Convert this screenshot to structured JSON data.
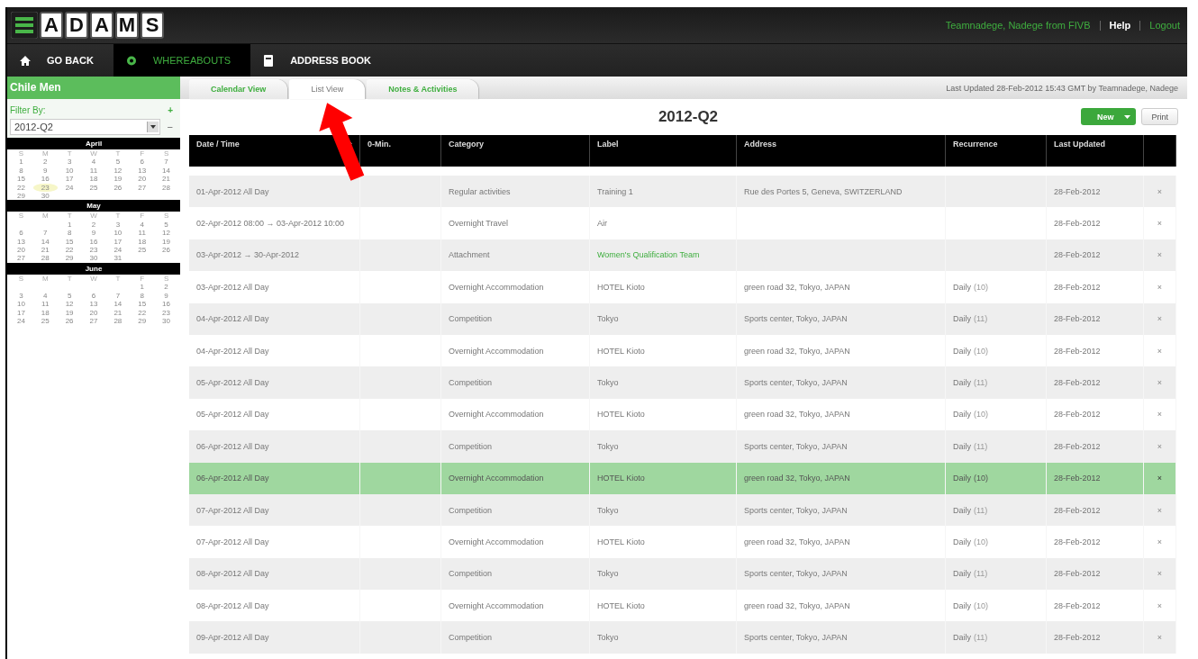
{
  "header": {
    "logo": [
      "A",
      "D",
      "A",
      "M",
      "S"
    ],
    "user": "Teamnadege, Nadege from FIVB",
    "links": [
      "Help",
      "Logout"
    ]
  },
  "nav": [
    {
      "label": "GO BACK",
      "kind": "home",
      "selected": false
    },
    {
      "label": "WHEREABOUTS",
      "kind": "pin",
      "selected": true
    },
    {
      "label": "ADDRESS BOOK",
      "kind": "book",
      "selected": false
    }
  ],
  "sidebar": {
    "title": "Chile Men",
    "filter_label": "Filter By:",
    "add": "+",
    "period": "2012-Q2",
    "remove": "−",
    "months": [
      {
        "name": "April",
        "weekdays": [
          "S",
          "M",
          "T",
          "W",
          "T",
          "F",
          "S"
        ],
        "weeks": [
          [
            "1",
            "2",
            "3",
            "4",
            "5",
            "6",
            "7"
          ],
          [
            "8",
            "9",
            "10",
            "11",
            "12",
            "13",
            "14"
          ],
          [
            "15",
            "16",
            "17",
            "18",
            "19",
            "20",
            "21"
          ],
          [
            "22",
            {
              "day": "23",
              "marked": true
            },
            "24",
            "25",
            "26",
            "27",
            "28"
          ],
          [
            "29",
            "30"
          ]
        ]
      },
      {
        "name": "May",
        "weekdays": [
          "S",
          "M",
          "T",
          "W",
          "T",
          "F",
          "S"
        ],
        "weeks": [
          [
            "1",
            "2",
            "3",
            "4",
            "5"
          ],
          [
            "6",
            "7",
            "8",
            "9",
            "10",
            "11",
            "12"
          ],
          [
            "13",
            "14",
            "15",
            "16",
            "17",
            "18",
            "19"
          ],
          [
            "20",
            "21",
            "22",
            "23",
            "24",
            "25",
            "26"
          ],
          [
            "27",
            "28",
            "29",
            "30",
            "31"
          ]
        ]
      },
      {
        "name": "June",
        "weekdays": [
          "S",
          "M",
          "T",
          "W",
          "T",
          "F",
          "S"
        ],
        "weeks": [
          [
            "1",
            "2"
          ],
          [
            "3",
            "4",
            "5",
            "6",
            "7",
            "8",
            "9"
          ],
          [
            "10",
            "11",
            "12",
            "13",
            "14",
            "15",
            "16"
          ],
          [
            "17",
            "18",
            "19",
            "20",
            "21",
            "22",
            "23"
          ],
          [
            "24",
            "25",
            "26",
            "27",
            "28",
            "29",
            "30"
          ]
        ]
      }
    ]
  },
  "tabs": [
    {
      "label": "Calendar View",
      "selected": false
    },
    {
      "label": "List View",
      "selected": true
    },
    {
      "label": "Notes & Activities",
      "selected": false
    }
  ],
  "last_updated": "Last Updated 28-Feb-2012 15:43 GMT by Teamnadege, Nadege",
  "title": "2012-Q2",
  "buttons": {
    "new": "New",
    "print": "Print"
  },
  "table": {
    "columns": [
      "Date / Time",
      "0-Min.",
      "Category",
      "Label",
      "Address",
      "Recurrence",
      "Last Updated"
    ],
    "rows": [
      {
        "date": "01-Apr-2012 All Day",
        "category": "Regular activities",
        "label": "Training 1",
        "address": "Rue des Portes 5, Geneva, SWITZERLAND",
        "updated": "28-Feb-2012",
        "selected": false
      },
      {
        "date": "02-Apr-2012 08:00 → 03-Apr-2012 10:00",
        "category": "Overnight Travel",
        "label": "Air",
        "updated": "28-Feb-2012",
        "selected": false
      },
      {
        "date": "03-Apr-2012 → 30-Apr-2012",
        "category": "Attachment",
        "label": "Women's Qualification Team",
        "link": true,
        "updated": "28-Feb-2012",
        "selected": false
      },
      {
        "date": "03-Apr-2012 All Day",
        "category": "Overnight Accommodation",
        "label": "HOTEL Kioto",
        "address": "green road 32, Tokyo, JAPAN",
        "recurrence": "Daily",
        "count": "(10)",
        "updated": "28-Feb-2012",
        "selected": false
      },
      {
        "date": "04-Apr-2012 All Day",
        "category": "Competition",
        "label": "Tokyo",
        "address": "Sports center, Tokyo, JAPAN",
        "recurrence": "Daily",
        "count": "(11)",
        "updated": "28-Feb-2012",
        "selected": false
      },
      {
        "date": "04-Apr-2012 All Day",
        "category": "Overnight Accommodation",
        "label": "HOTEL Kioto",
        "address": "green road 32, Tokyo, JAPAN",
        "recurrence": "Daily",
        "count": "(10)",
        "updated": "28-Feb-2012",
        "selected": false
      },
      {
        "date": "05-Apr-2012 All Day",
        "category": "Competition",
        "label": "Tokyo",
        "address": "Sports center, Tokyo, JAPAN",
        "recurrence": "Daily",
        "count": "(11)",
        "updated": "28-Feb-2012",
        "selected": false
      },
      {
        "date": "05-Apr-2012 All Day",
        "category": "Overnight Accommodation",
        "label": "HOTEL Kioto",
        "address": "green road 32, Tokyo, JAPAN",
        "recurrence": "Daily",
        "count": "(10)",
        "updated": "28-Feb-2012",
        "selected": false
      },
      {
        "date": "06-Apr-2012 All Day",
        "category": "Competition",
        "label": "Tokyo",
        "address": "Sports center, Tokyo, JAPAN",
        "recurrence": "Daily",
        "count": "(11)",
        "updated": "28-Feb-2012",
        "selected": false
      },
      {
        "date": "06-Apr-2012 All Day",
        "category": "Overnight Accommodation",
        "label": "HOTEL Kioto",
        "address": "green road 32, Tokyo, JAPAN",
        "recurrence": "Daily",
        "count": "(10)",
        "updated": "28-Feb-2012",
        "selected": true
      },
      {
        "date": "07-Apr-2012 All Day",
        "category": "Competition",
        "label": "Tokyo",
        "address": "Sports center, Tokyo, JAPAN",
        "recurrence": "Daily",
        "count": "(11)",
        "updated": "28-Feb-2012",
        "selected": false
      },
      {
        "date": "07-Apr-2012 All Day",
        "category": "Overnight Accommodation",
        "label": "HOTEL Kioto",
        "address": "green road 32, Tokyo, JAPAN",
        "recurrence": "Daily",
        "count": "(10)",
        "updated": "28-Feb-2012",
        "selected": false
      },
      {
        "date": "08-Apr-2012 All Day",
        "category": "Competition",
        "label": "Tokyo",
        "address": "Sports center, Tokyo, JAPAN",
        "recurrence": "Daily",
        "count": "(11)",
        "updated": "28-Feb-2012",
        "selected": false
      },
      {
        "date": "08-Apr-2012 All Day",
        "category": "Overnight Accommodation",
        "label": "HOTEL Kioto",
        "address": "green road 32, Tokyo, JAPAN",
        "recurrence": "Daily",
        "count": "(10)",
        "updated": "28-Feb-2012",
        "selected": false
      },
      {
        "date": "09-Apr-2012 All Day",
        "category": "Competition",
        "label": "Tokyo",
        "address": "Sports center, Tokyo, JAPAN",
        "recurrence": "Daily",
        "count": "(11)",
        "updated": "28-Feb-2012",
        "selected": false
      }
    ],
    "delete": "×"
  }
}
